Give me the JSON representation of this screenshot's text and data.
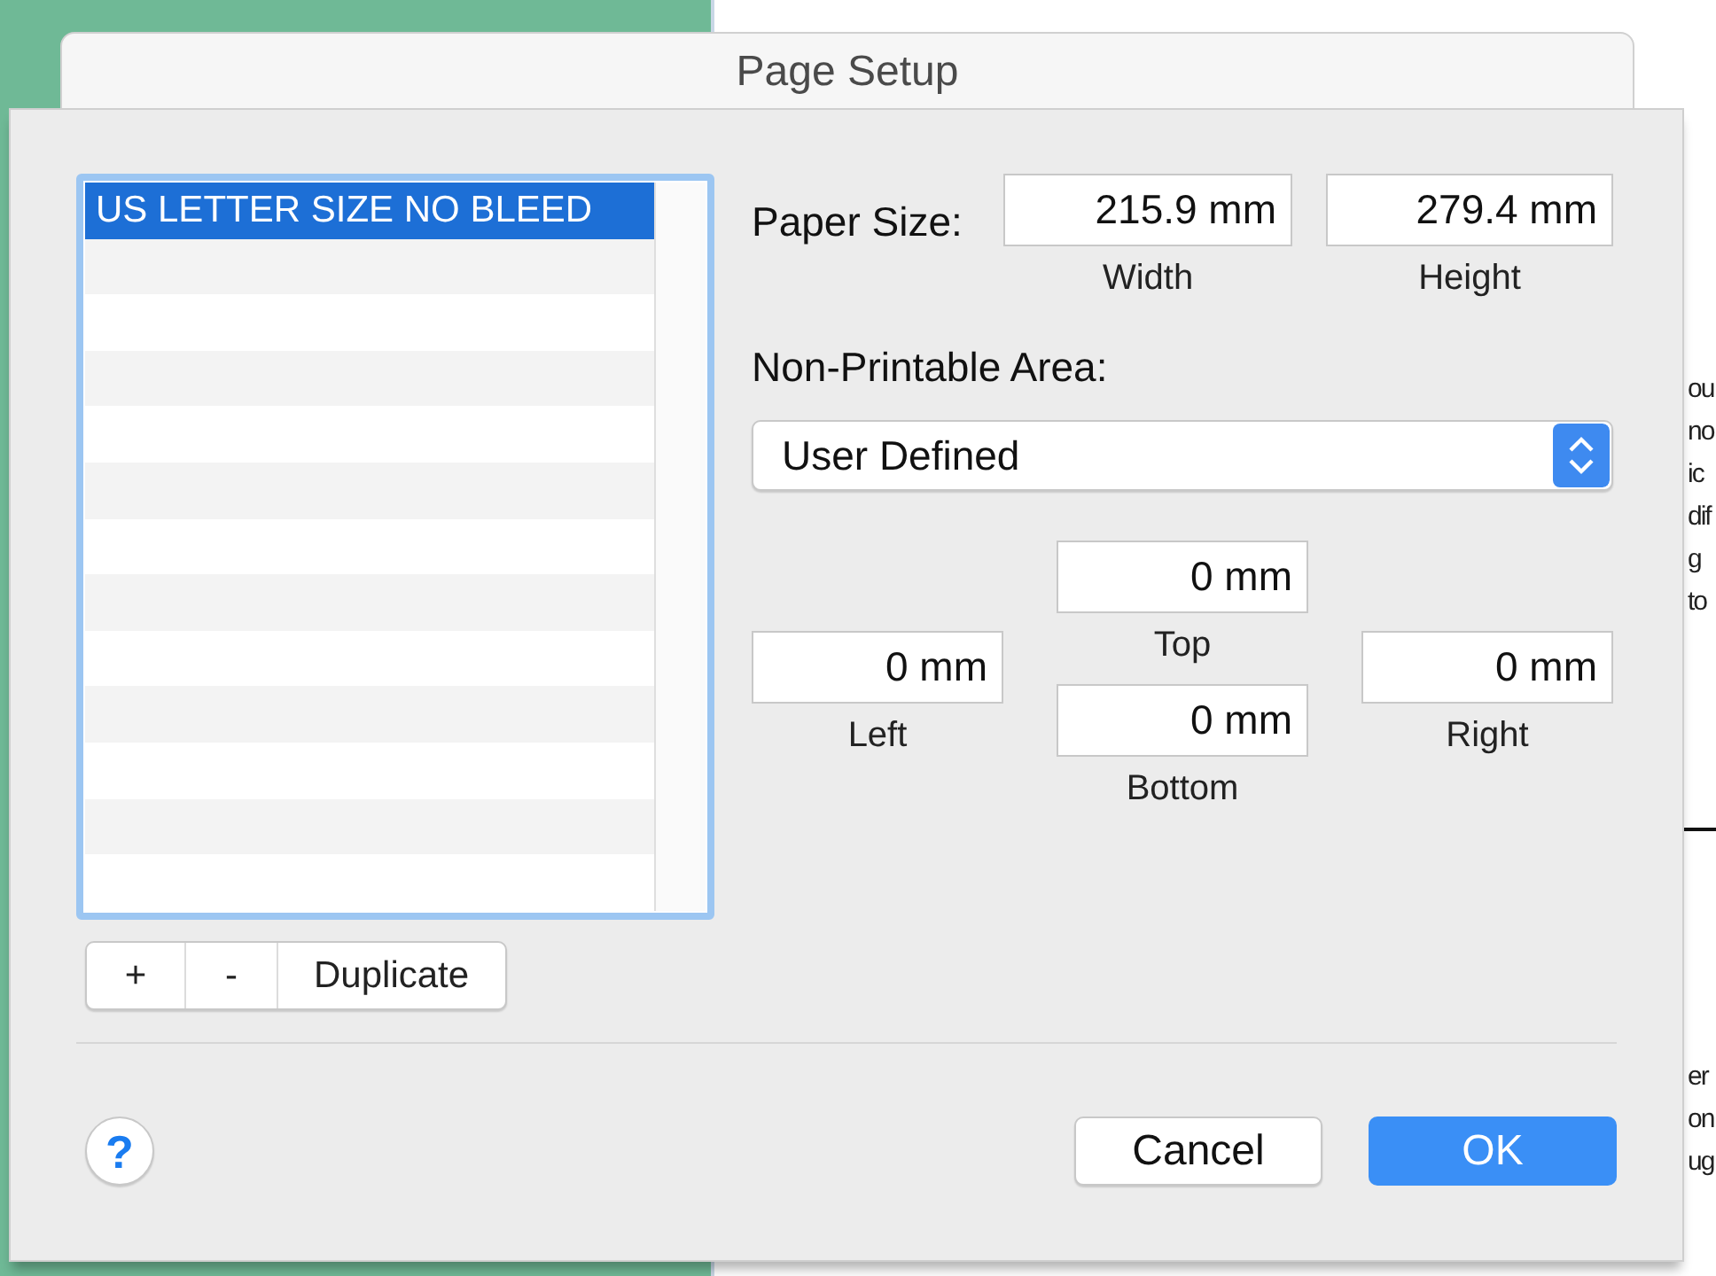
{
  "background_document": {
    "lines_top": [
      "ou",
      "no",
      "ic",
      "dif",
      "g",
      "to"
    ],
    "lines_bottom": [
      "er",
      "on",
      "ug"
    ]
  },
  "window": {
    "title": "Page Setup"
  },
  "paper_list": {
    "items": [
      {
        "label": "US LETTER SIZE NO BLEED",
        "selected": true
      }
    ]
  },
  "list_buttons": [
    "+",
    "-",
    "Duplicate"
  ],
  "paper_size": {
    "label": "Paper Size:",
    "width": {
      "value": "215.9 mm",
      "label": "Width"
    },
    "height": {
      "value": "279.4 mm",
      "label": "Height"
    }
  },
  "non_printable_area": {
    "label": "Non-Printable Area:",
    "value": "User Defined"
  },
  "margins": {
    "top": {
      "value": "0 mm",
      "label": "Top"
    },
    "left": {
      "value": "0 mm",
      "label": "Left"
    },
    "right": {
      "value": "0 mm",
      "label": "Right"
    },
    "bottom": {
      "value": "0 mm",
      "label": "Bottom"
    }
  },
  "help": {
    "label": "?"
  },
  "buttons": [
    {
      "label": "Cancel",
      "kind": "secondary"
    },
    {
      "label": "OK",
      "kind": "primary"
    }
  ]
}
